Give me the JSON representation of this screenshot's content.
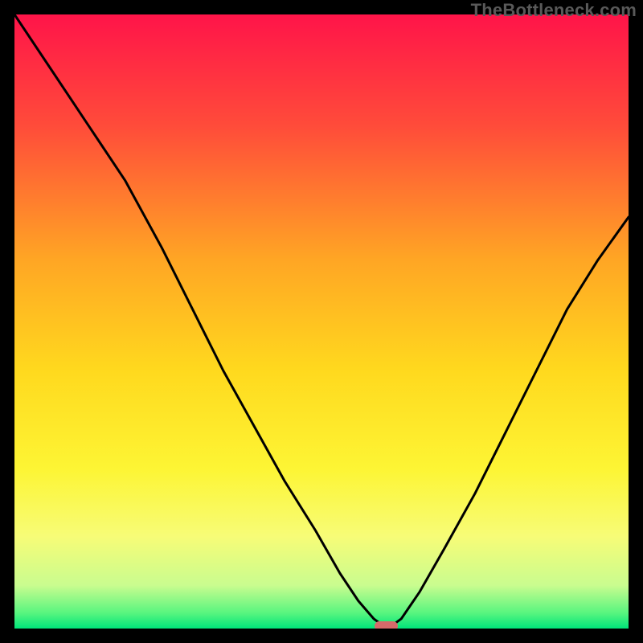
{
  "watermark": "TheBottleneck.com",
  "chart_data": {
    "type": "line",
    "title": "",
    "xlabel": "",
    "ylabel": "",
    "xlim": [
      0,
      100
    ],
    "ylim": [
      0,
      100
    ],
    "grid": false,
    "legend": false,
    "series": [
      {
        "name": "bottleneck-curve",
        "x": [
          0,
          6,
          12,
          18,
          24,
          29,
          34,
          39,
          44,
          49,
          53,
          56,
          58.5,
          60,
          61.5,
          63,
          66,
          70,
          75,
          80,
          85,
          90,
          95,
          100
        ],
        "y": [
          100,
          91,
          82,
          73,
          62,
          52,
          42,
          33,
          24,
          16,
          9,
          4.5,
          1.6,
          0.5,
          0.5,
          1.6,
          6,
          13,
          22,
          32,
          42,
          52,
          60,
          67
        ],
        "color": "#000000"
      }
    ],
    "marker": {
      "name": "optimal-marker",
      "x_center": 60.5,
      "width_pct": 3.8,
      "y_pct": 0.0,
      "height_pct": 1.6,
      "color": "#d66a6a"
    },
    "gradient_stops": [
      {
        "offset": 0.0,
        "color": "#ff1449"
      },
      {
        "offset": 0.18,
        "color": "#ff4b3a"
      },
      {
        "offset": 0.4,
        "color": "#ffa624"
      },
      {
        "offset": 0.58,
        "color": "#ffd91e"
      },
      {
        "offset": 0.74,
        "color": "#fdf534"
      },
      {
        "offset": 0.85,
        "color": "#f7fc77"
      },
      {
        "offset": 0.93,
        "color": "#c9fc8f"
      },
      {
        "offset": 0.975,
        "color": "#57f57f"
      },
      {
        "offset": 1.0,
        "color": "#00e57a"
      }
    ]
  }
}
